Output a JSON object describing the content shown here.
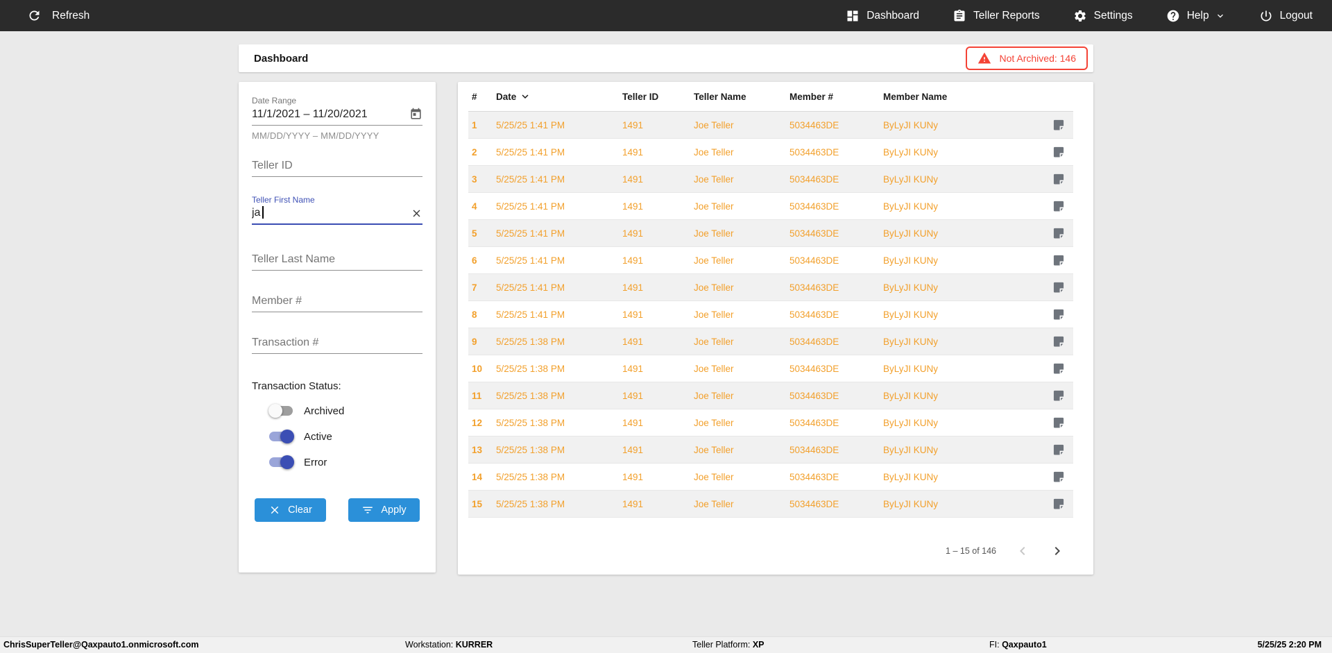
{
  "navbar": {
    "refresh_label": "Refresh",
    "dashboard_label": "Dashboard",
    "teller_reports_label": "Teller Reports",
    "settings_label": "Settings",
    "help_label": "Help",
    "logout_label": "Logout"
  },
  "header": {
    "title": "Dashboard",
    "not_archived_label": "Not Archived: 146"
  },
  "filters": {
    "date_range": {
      "label": "Date Range",
      "value": "11/1/2021 – 11/20/2021",
      "hint": "MM/DD/YYYY – MM/DD/YYYY"
    },
    "teller_id": {
      "placeholder": "Teller ID"
    },
    "teller_first_name": {
      "label": "Teller First Name",
      "value": "ja"
    },
    "teller_last_name": {
      "placeholder": "Teller Last Name"
    },
    "member_number": {
      "placeholder": "Member #"
    },
    "transaction_number": {
      "placeholder": "Transaction #"
    },
    "status": {
      "label": "Transaction Status:",
      "toggles": [
        {
          "label": "Archived",
          "on": false
        },
        {
          "label": "Active",
          "on": true
        },
        {
          "label": "Error",
          "on": true
        }
      ]
    },
    "clear_label": "Clear",
    "apply_label": "Apply"
  },
  "table": {
    "columns": [
      "#",
      "Date",
      "Teller ID",
      "Teller Name",
      "Member #",
      "Member Name"
    ],
    "sort": {
      "column": "Date",
      "direction": "desc"
    },
    "rows": [
      {
        "num": "1",
        "date": "5/25/25 1:41 PM",
        "teller_id": "1491",
        "teller_name": "Joe Teller",
        "member_num": "5034463DE",
        "member_name": "ByLyJI KUNy"
      },
      {
        "num": "2",
        "date": "5/25/25 1:41 PM",
        "teller_id": "1491",
        "teller_name": "Joe Teller",
        "member_num": "5034463DE",
        "member_name": "ByLyJI KUNy"
      },
      {
        "num": "3",
        "date": "5/25/25 1:41 PM",
        "teller_id": "1491",
        "teller_name": "Joe Teller",
        "member_num": "5034463DE",
        "member_name": "ByLyJI KUNy"
      },
      {
        "num": "4",
        "date": "5/25/25 1:41 PM",
        "teller_id": "1491",
        "teller_name": "Joe Teller",
        "member_num": "5034463DE",
        "member_name": "ByLyJI KUNy"
      },
      {
        "num": "5",
        "date": "5/25/25 1:41 PM",
        "teller_id": "1491",
        "teller_name": "Joe Teller",
        "member_num": "5034463DE",
        "member_name": "ByLyJI KUNy"
      },
      {
        "num": "6",
        "date": "5/25/25 1:41 PM",
        "teller_id": "1491",
        "teller_name": "Joe Teller",
        "member_num": "5034463DE",
        "member_name": "ByLyJI KUNy"
      },
      {
        "num": "7",
        "date": "5/25/25 1:41 PM",
        "teller_id": "1491",
        "teller_name": "Joe Teller",
        "member_num": "5034463DE",
        "member_name": "ByLyJI KUNy"
      },
      {
        "num": "8",
        "date": "5/25/25 1:41 PM",
        "teller_id": "1491",
        "teller_name": "Joe Teller",
        "member_num": "5034463DE",
        "member_name": "ByLyJI KUNy"
      },
      {
        "num": "9",
        "date": "5/25/25 1:38 PM",
        "teller_id": "1491",
        "teller_name": "Joe Teller",
        "member_num": "5034463DE",
        "member_name": "ByLyJI KUNy"
      },
      {
        "num": "10",
        "date": "5/25/25 1:38 PM",
        "teller_id": "1491",
        "teller_name": "Joe Teller",
        "member_num": "5034463DE",
        "member_name": "ByLyJI KUNy"
      },
      {
        "num": "11",
        "date": "5/25/25 1:38 PM",
        "teller_id": "1491",
        "teller_name": "Joe Teller",
        "member_num": "5034463DE",
        "member_name": "ByLyJI KUNy"
      },
      {
        "num": "12",
        "date": "5/25/25 1:38 PM",
        "teller_id": "1491",
        "teller_name": "Joe Teller",
        "member_num": "5034463DE",
        "member_name": "ByLyJI KUNy"
      },
      {
        "num": "13",
        "date": "5/25/25 1:38 PM",
        "teller_id": "1491",
        "teller_name": "Joe Teller",
        "member_num": "5034463DE",
        "member_name": "ByLyJI KUNy"
      },
      {
        "num": "14",
        "date": "5/25/25 1:38 PM",
        "teller_id": "1491",
        "teller_name": "Joe Teller",
        "member_num": "5034463DE",
        "member_name": "ByLyJI KUNy"
      },
      {
        "num": "15",
        "date": "5/25/25 1:38 PM",
        "teller_id": "1491",
        "teller_name": "Joe Teller",
        "member_num": "5034463DE",
        "member_name": "ByLyJI KUNy"
      }
    ],
    "pagination": {
      "range_label": "1 – 15 of 146"
    }
  },
  "statusbar": {
    "user": "ChrisSuperTeller@Qaxpauto1.onmicrosoft.com",
    "workstation_label": "Workstation: ",
    "workstation_value": "KURRER",
    "platform_label": "Teller Platform: ",
    "platform_value": "XP",
    "fi_label": "FI: ",
    "fi_value": "Qaxpauto1",
    "datetime": "5/25/25 2:20 PM"
  },
  "icons": {
    "refresh": "circular-arrow",
    "dashboard": "grid-tiles",
    "teller_reports": "clipboard",
    "settings": "gear",
    "help": "question-circle",
    "logout": "power",
    "alert": "warning-triangle",
    "date_picker": "calendar",
    "clear_field": "x",
    "clear_button": "x",
    "apply_button": "filter-lines",
    "row_action": "note",
    "sort": "chevron-down"
  },
  "colors": {
    "navbar_bg": "#2B2B2B",
    "accent_orange": "#F2A02C",
    "accent_blue": "#2B90D9",
    "accent_indigo": "#3F51B5",
    "alert_red": "#F44336",
    "stripe_gray": "#F1F1F1"
  }
}
